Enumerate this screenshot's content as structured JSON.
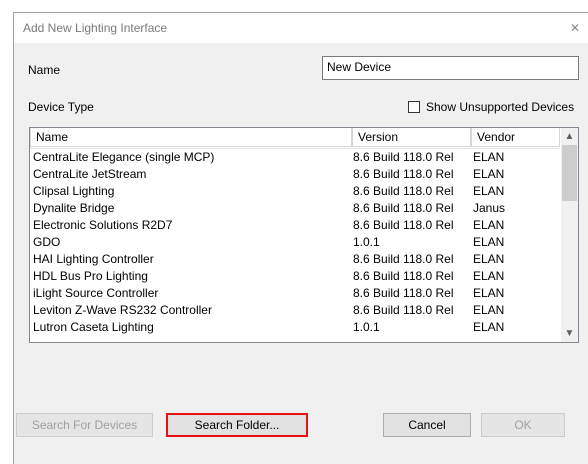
{
  "window": {
    "title": "Add New Lighting Interface",
    "close_glyph": "✕"
  },
  "form": {
    "name_label": "Name",
    "name_value": "New Device",
    "device_type_label": "Device Type",
    "show_unsupported_label": "Show Unsupported Devices",
    "show_unsupported_checked": false
  },
  "table": {
    "columns": [
      "Name",
      "Version",
      "Vendor"
    ],
    "rows": [
      {
        "name": "CentraLite Elegance (single MCP)",
        "version": "8.6 Build 118.0 Rel",
        "vendor": "ELAN"
      },
      {
        "name": "CentraLite JetStream",
        "version": "8.6 Build 118.0 Rel",
        "vendor": "ELAN"
      },
      {
        "name": "Clipsal Lighting",
        "version": "8.6 Build 118.0 Rel",
        "vendor": "ELAN"
      },
      {
        "name": "Dynalite Bridge",
        "version": "8.6 Build 118.0 Rel",
        "vendor": "Janus"
      },
      {
        "name": "Electronic Solutions R2D7",
        "version": "8.6 Build 118.0 Rel",
        "vendor": "ELAN"
      },
      {
        "name": "GDO",
        "version": "1.0.1",
        "vendor": "ELAN"
      },
      {
        "name": "HAI Lighting Controller",
        "version": "8.6 Build 118.0 Rel",
        "vendor": "ELAN"
      },
      {
        "name": "HDL Bus Pro Lighting",
        "version": "8.6 Build 118.0 Rel",
        "vendor": "ELAN"
      },
      {
        "name": "iLight Source Controller",
        "version": "8.6 Build 118.0 Rel",
        "vendor": "ELAN"
      },
      {
        "name": "Leviton Z-Wave RS232 Controller",
        "version": "8.6 Build 118.0 Rel",
        "vendor": "ELAN"
      },
      {
        "name": "Lutron Caseta Lighting",
        "version": "1.0.1",
        "vendor": "ELAN"
      }
    ]
  },
  "buttons": {
    "search_devices": "Search For Devices",
    "search_folder": "Search Folder...",
    "cancel": "Cancel",
    "ok": "OK"
  },
  "colors": {
    "highlight_border": "#e81010",
    "dialog_bg": "#f0f0f0"
  }
}
